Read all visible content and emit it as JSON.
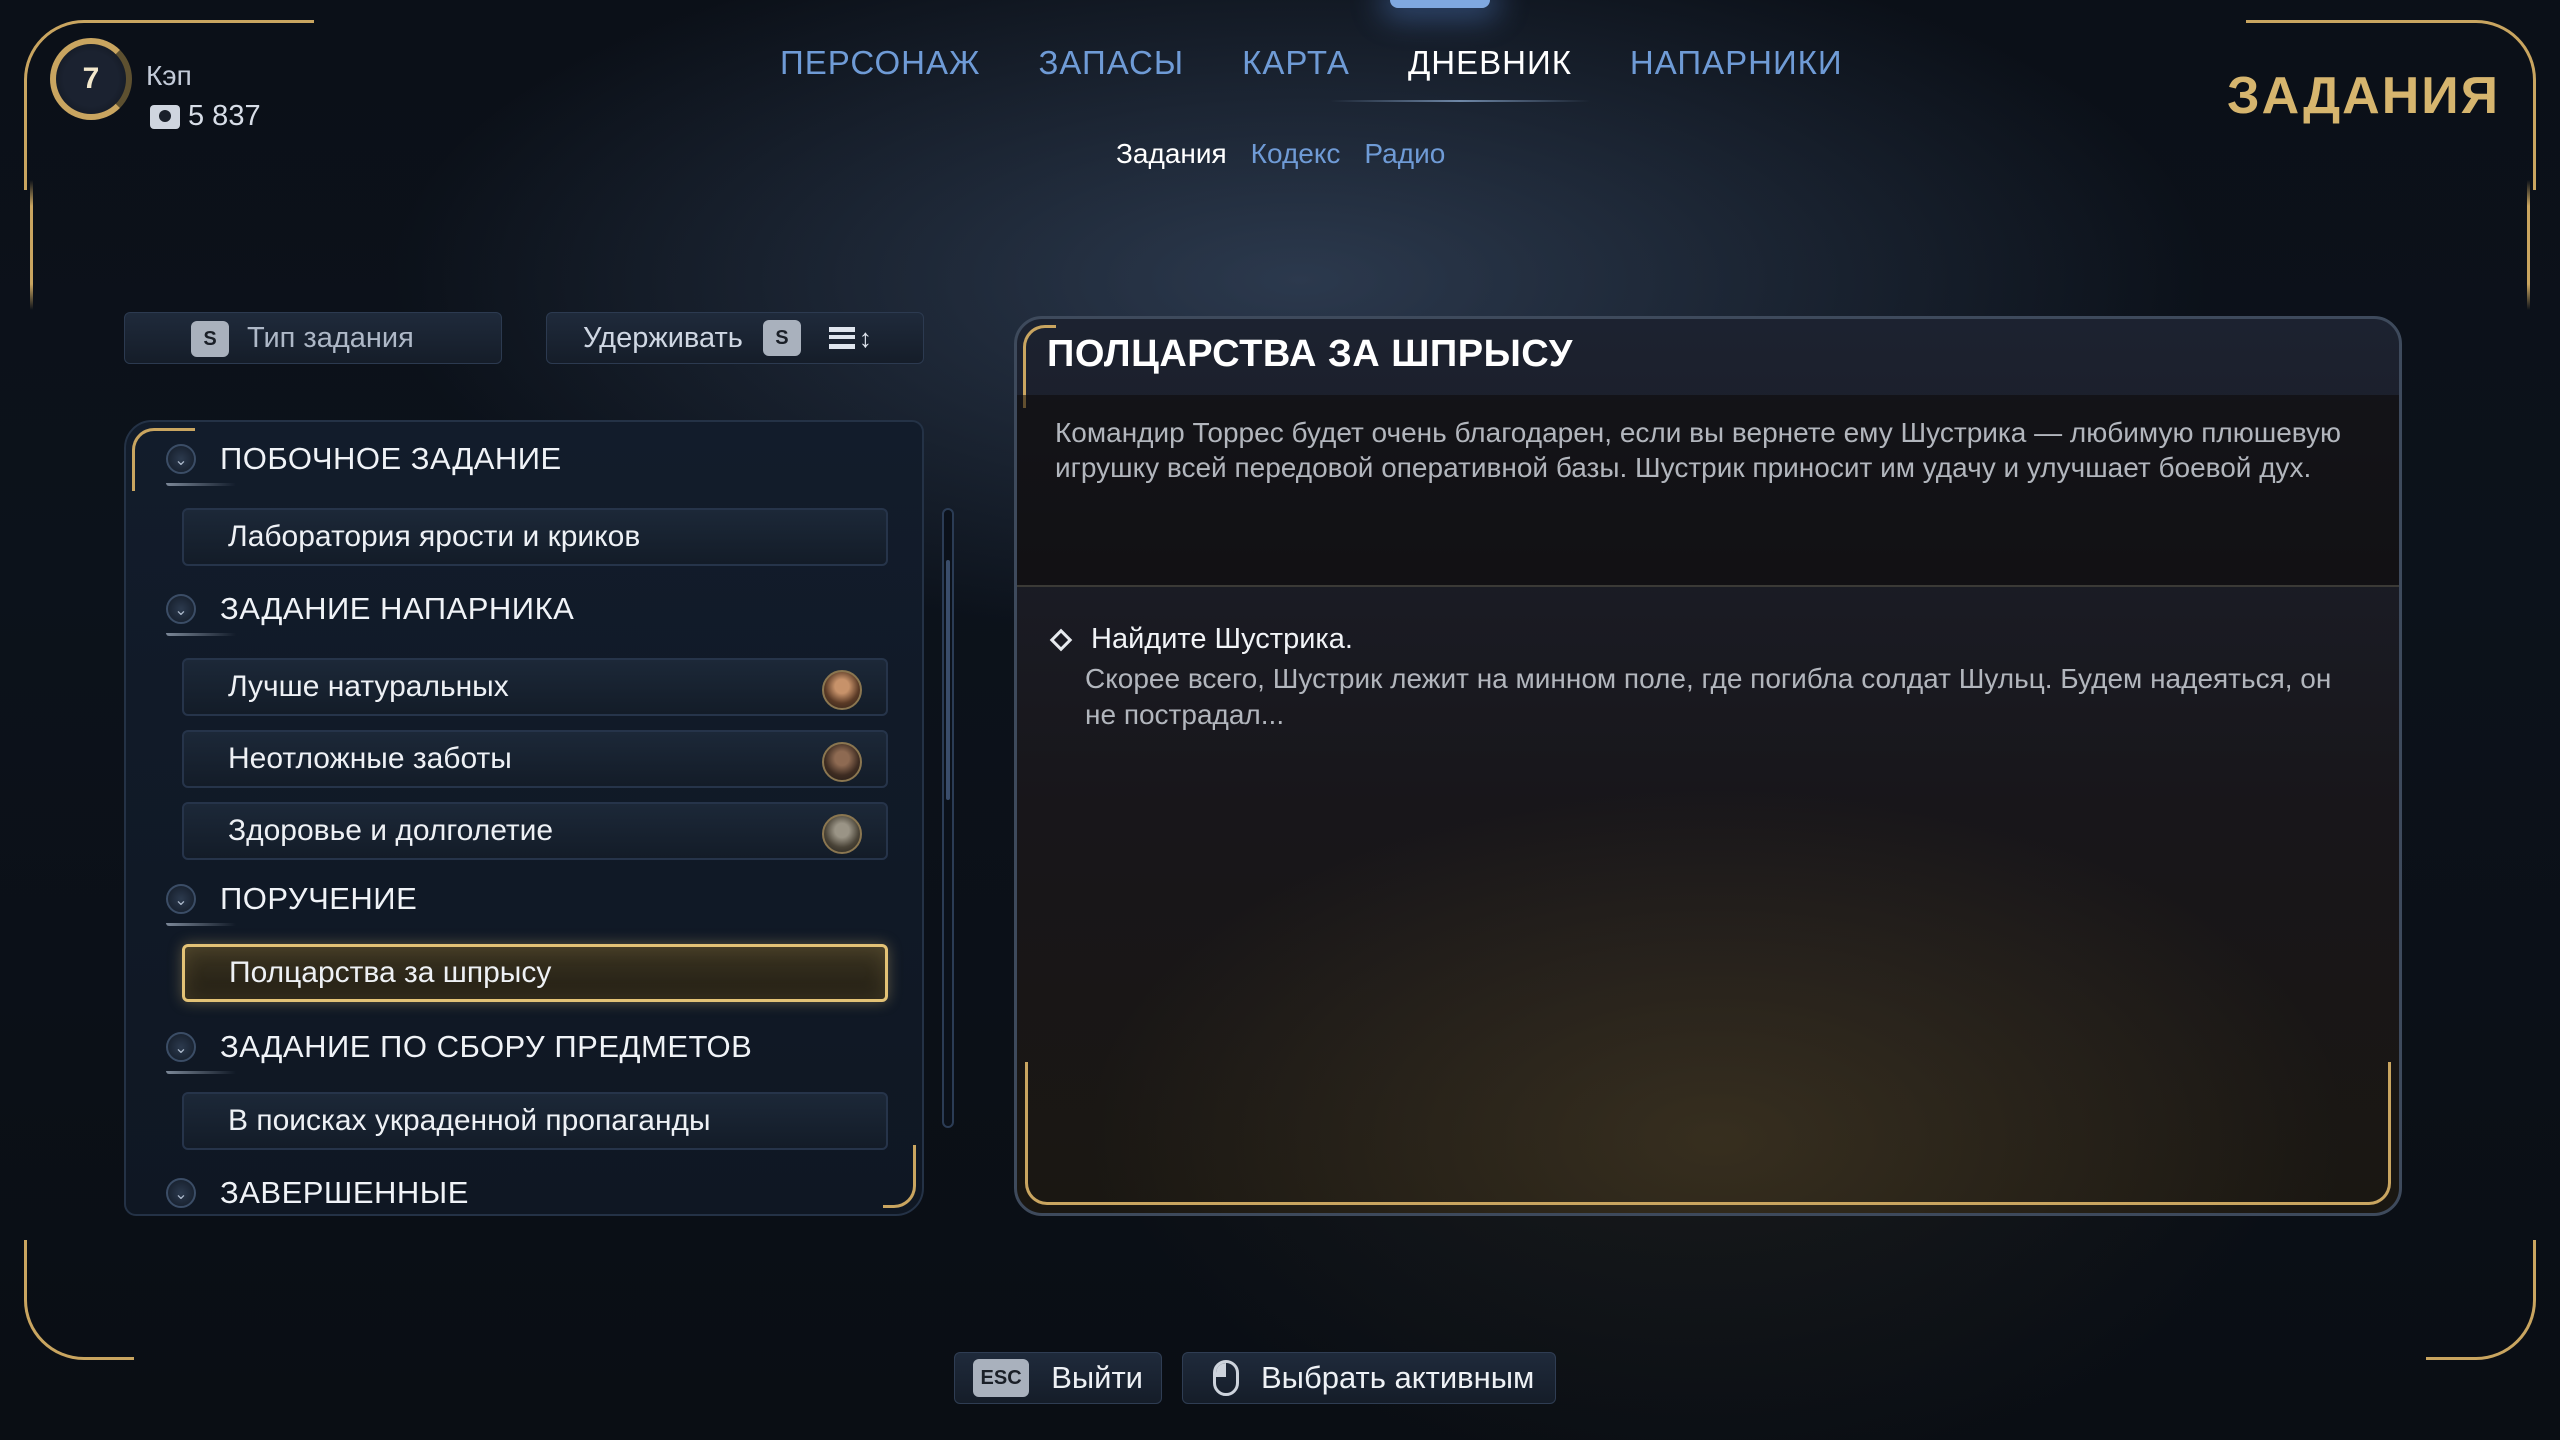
{
  "player": {
    "level": "7",
    "name": "Кэп",
    "caps": "5 837"
  },
  "nav": {
    "tabs": [
      "ПЕРСОНАЖ",
      "ЗАПАСЫ",
      "КАРТА",
      "ДНЕВНИК",
      "НАПАРНИКИ"
    ],
    "active_tab": "ДНЕВНИК",
    "subtabs": [
      "Задания",
      "Кодекс",
      "Радио"
    ],
    "active_subtab": "Задания"
  },
  "screen_title": "ЗАДАНИЯ",
  "filters": {
    "type_key": "S",
    "type_label": "Тип задания",
    "hold_label": "Удерживать",
    "hold_key": "S"
  },
  "quest_list": {
    "categories": [
      {
        "label": "ПОБОЧНОЕ ЗАДАНИЕ",
        "quests": [
          {
            "label": "Лаборатория ярости и криков"
          }
        ]
      },
      {
        "label": "ЗАДАНИЕ НАПАРНИКА",
        "quests": [
          {
            "label": "Лучше натуральных",
            "portrait": "companion-portrait-1"
          },
          {
            "label": "Неотложные заботы",
            "portrait": "companion-portrait-2"
          },
          {
            "label": "Здоровье и долголетие",
            "portrait": "companion-portrait-3"
          }
        ]
      },
      {
        "label": "ПОРУЧЕНИЕ",
        "quests": [
          {
            "label": "Полцарства за шпрысу",
            "selected": true
          }
        ]
      },
      {
        "label": "ЗАДАНИЕ ПО СБОРУ ПРЕДМЕТОВ",
        "quests": [
          {
            "label": "В поисках украденной пропаганды"
          }
        ]
      },
      {
        "label": "ЗАВЕРШЕННЫЕ",
        "quests": []
      }
    ]
  },
  "detail": {
    "title": "ПОЛЦАРСТВА ЗА ШПРЫСУ",
    "description": "Командир Торрес будет очень благодарен, если вы вернете ему Шустрика — любимую плюшевую игрушку всей передовой оперативной базы. Шустрик приносит им удачу и улучшает боевой дух.",
    "objective_title": "Найдите Шустрика.",
    "objective_text": "Скорее всего, Шустрик лежит на минном поле, где погибла солдат Шульц. Будем надеяться, он не пострадал..."
  },
  "prompts": {
    "exit_key": "ESC",
    "exit_label": "Выйти",
    "select_label": "Выбрать активным"
  },
  "colors": {
    "accent_gold": "#c9a560",
    "tab_inactive": "#6f9bd6",
    "selected_border": "#e3c276"
  }
}
